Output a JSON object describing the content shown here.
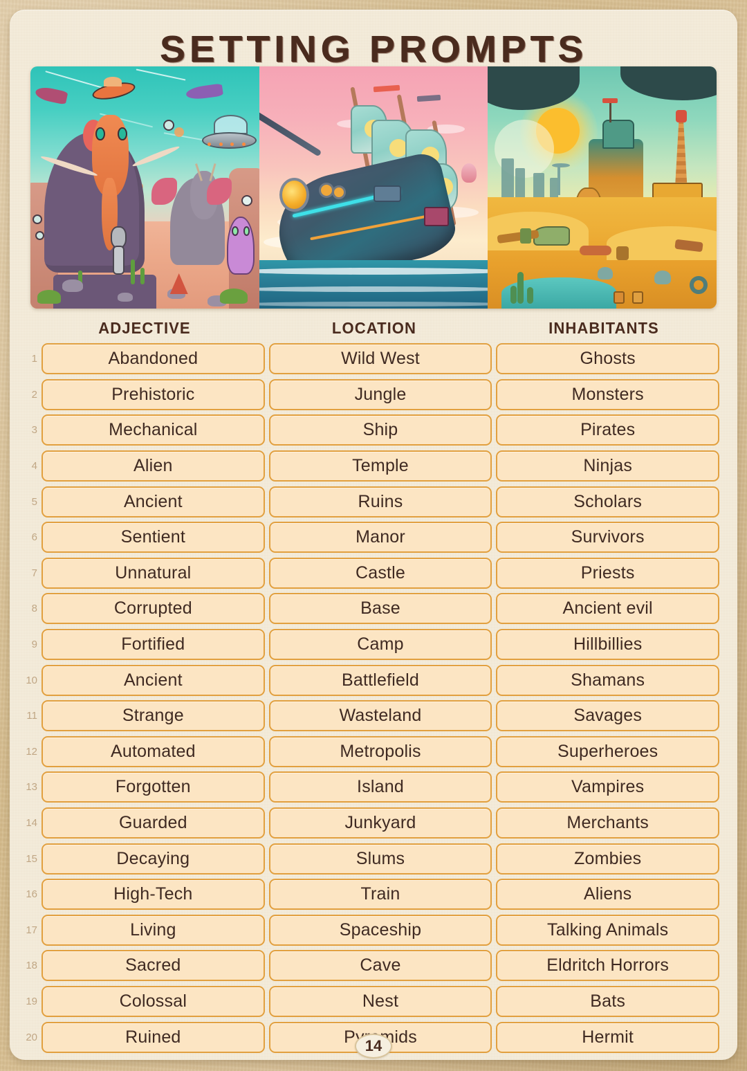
{
  "page": {
    "title": "SETTING PROMPTS",
    "page_number": "14",
    "colors": {
      "frame": "#d7bf93",
      "sheet": "#f3ebda",
      "title_text": "#4a2b1e",
      "cell_fill": "#fce5c3",
      "cell_border": "#e2a03f",
      "cell_text": "#3f2a22",
      "row_number": "#c0a684"
    }
  },
  "illustrations": [
    {
      "name": "prehistoric-alien-desert",
      "description": "Pixel-art desert with woolly mammoth, winged antlered elephant, robot skeleton, purple blob alien, UFOs and rocket ships under a teal sky"
    },
    {
      "name": "steampunk-airship-at-sea",
      "description": "Pixel-art mechanical sailing ship with glowing neon trim riding ocean waves at sunset under a pink sky"
    },
    {
      "name": "post-apocalyptic-wasteland",
      "description": "Pixel-art ruined desert town with rusted tower, wrecked car, oasis pool and blazing sun in a green sky"
    }
  ],
  "table": {
    "headers": [
      "ADJECTIVE",
      "LOCATION",
      "INHABITANTS"
    ],
    "rows": [
      {
        "n": "1",
        "adjective": "Abandoned",
        "location": "Wild West",
        "inhabitants": "Ghosts"
      },
      {
        "n": "2",
        "adjective": "Prehistoric",
        "location": "Jungle",
        "inhabitants": "Monsters"
      },
      {
        "n": "3",
        "adjective": "Mechanical",
        "location": "Ship",
        "inhabitants": "Pirates"
      },
      {
        "n": "4",
        "adjective": "Alien",
        "location": "Temple",
        "inhabitants": "Ninjas"
      },
      {
        "n": "5",
        "adjective": "Ancient",
        "location": "Ruins",
        "inhabitants": "Scholars"
      },
      {
        "n": "6",
        "adjective": "Sentient",
        "location": "Manor",
        "inhabitants": "Survivors"
      },
      {
        "n": "7",
        "adjective": "Unnatural",
        "location": "Castle",
        "inhabitants": "Priests"
      },
      {
        "n": "8",
        "adjective": "Corrupted",
        "location": "Base",
        "inhabitants": "Ancient evil"
      },
      {
        "n": "9",
        "adjective": "Fortified",
        "location": "Camp",
        "inhabitants": "Hillbillies"
      },
      {
        "n": "10",
        "adjective": "Ancient",
        "location": "Battlefield",
        "inhabitants": "Shamans"
      },
      {
        "n": "11",
        "adjective": "Strange",
        "location": "Wasteland",
        "inhabitants": "Savages"
      },
      {
        "n": "12",
        "adjective": "Automated",
        "location": "Metropolis",
        "inhabitants": "Superheroes"
      },
      {
        "n": "13",
        "adjective": "Forgotten",
        "location": "Island",
        "inhabitants": "Vampires"
      },
      {
        "n": "14",
        "adjective": "Guarded",
        "location": "Junkyard",
        "inhabitants": "Merchants"
      },
      {
        "n": "15",
        "adjective": "Decaying",
        "location": "Slums",
        "inhabitants": "Zombies"
      },
      {
        "n": "16",
        "adjective": "High-Tech",
        "location": "Train",
        "inhabitants": "Aliens"
      },
      {
        "n": "17",
        "adjective": "Living",
        "location": "Spaceship",
        "inhabitants": "Talking Animals"
      },
      {
        "n": "18",
        "adjective": "Sacred",
        "location": "Cave",
        "inhabitants": "Eldritch Horrors"
      },
      {
        "n": "19",
        "adjective": "Colossal",
        "location": "Nest",
        "inhabitants": "Bats"
      },
      {
        "n": "20",
        "adjective": "Ruined",
        "location": "Pyramids",
        "inhabitants": "Hermit"
      }
    ]
  }
}
